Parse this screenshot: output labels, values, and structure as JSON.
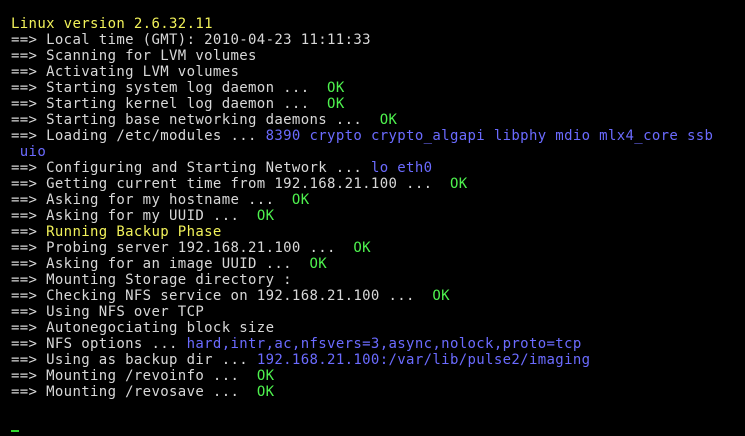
{
  "colors": {
    "background": "#000000",
    "default_text": "#d8d8d8",
    "highlight_yellow": "#f2f25a",
    "status_ok": "#4ef24e",
    "detail_blue": "#6b6bff",
    "cursor": "#2fd82f"
  },
  "lines": [
    {
      "segments": [
        {
          "text": "Linux version 2.6.32.11",
          "color": "yellow"
        }
      ]
    },
    {
      "segments": [
        {
          "text": "==> Local time (GMT): 2010-04-23 11:11:33",
          "color": "white"
        }
      ]
    },
    {
      "segments": [
        {
          "text": "==> Scanning for LVM volumes",
          "color": "white"
        }
      ]
    },
    {
      "segments": [
        {
          "text": "==> Activating LVM volumes",
          "color": "white"
        }
      ]
    },
    {
      "segments": [
        {
          "text": "==> Starting system log daemon ...  ",
          "color": "white"
        },
        {
          "text": "OK",
          "color": "green"
        }
      ]
    },
    {
      "segments": [
        {
          "text": "==> Starting kernel log daemon ...  ",
          "color": "white"
        },
        {
          "text": "OK",
          "color": "green"
        }
      ]
    },
    {
      "segments": [
        {
          "text": "==> Starting base networking daemons ...  ",
          "color": "white"
        },
        {
          "text": "OK",
          "color": "green"
        }
      ]
    },
    {
      "segments": [
        {
          "text": "==> Loading /etc/modules ... ",
          "color": "white"
        },
        {
          "text": "8390 crypto crypto_algapi libphy mdio mlx4_core ssb",
          "color": "blue"
        }
      ]
    },
    {
      "segments": [
        {
          "text": " uio",
          "color": "blue"
        }
      ]
    },
    {
      "segments": [
        {
          "text": "==> Configuring and Starting Network ... ",
          "color": "white"
        },
        {
          "text": "lo eth0",
          "color": "blue"
        }
      ]
    },
    {
      "segments": [
        {
          "text": "==> Getting current time from 192.168.21.100 ...  ",
          "color": "white"
        },
        {
          "text": "OK",
          "color": "green"
        }
      ]
    },
    {
      "segments": [
        {
          "text": "==> Asking for my hostname ...  ",
          "color": "white"
        },
        {
          "text": "OK",
          "color": "green"
        }
      ]
    },
    {
      "segments": [
        {
          "text": "==> Asking for my UUID ...  ",
          "color": "white"
        },
        {
          "text": "OK",
          "color": "green"
        }
      ]
    },
    {
      "segments": [
        {
          "text": "==> ",
          "color": "white"
        },
        {
          "text": "Running Backup Phase",
          "color": "yellow"
        }
      ]
    },
    {
      "segments": [
        {
          "text": "==> Probing server 192.168.21.100 ...  ",
          "color": "white"
        },
        {
          "text": "OK",
          "color": "green"
        }
      ]
    },
    {
      "segments": [
        {
          "text": "==> Asking for an image UUID ...  ",
          "color": "white"
        },
        {
          "text": "OK",
          "color": "green"
        }
      ]
    },
    {
      "segments": [
        {
          "text": "==> Mounting Storage directory :",
          "color": "white"
        }
      ]
    },
    {
      "segments": [
        {
          "text": "==> Checking NFS service on 192.168.21.100 ...  ",
          "color": "white"
        },
        {
          "text": "OK",
          "color": "green"
        }
      ]
    },
    {
      "segments": [
        {
          "text": "==> Using NFS over TCP",
          "color": "white"
        }
      ]
    },
    {
      "segments": [
        {
          "text": "==> Autonegociating block size",
          "color": "white"
        }
      ]
    },
    {
      "segments": [
        {
          "text": "==> NFS options ... ",
          "color": "white"
        },
        {
          "text": "hard,intr,ac,nfsvers=3,async,nolock,proto=tcp",
          "color": "blue"
        }
      ]
    },
    {
      "segments": [
        {
          "text": "==> Using as backup dir ... ",
          "color": "white"
        },
        {
          "text": "192.168.21.100:/var/lib/pulse2/imaging",
          "color": "blue"
        }
      ]
    },
    {
      "segments": [
        {
          "text": "==> Mounting /revoinfo ...  ",
          "color": "white"
        },
        {
          "text": "OK",
          "color": "green"
        }
      ]
    },
    {
      "segments": [
        {
          "text": "==> Mounting /revosave ...  ",
          "color": "white"
        },
        {
          "text": "OK",
          "color": "green"
        }
      ]
    }
  ]
}
